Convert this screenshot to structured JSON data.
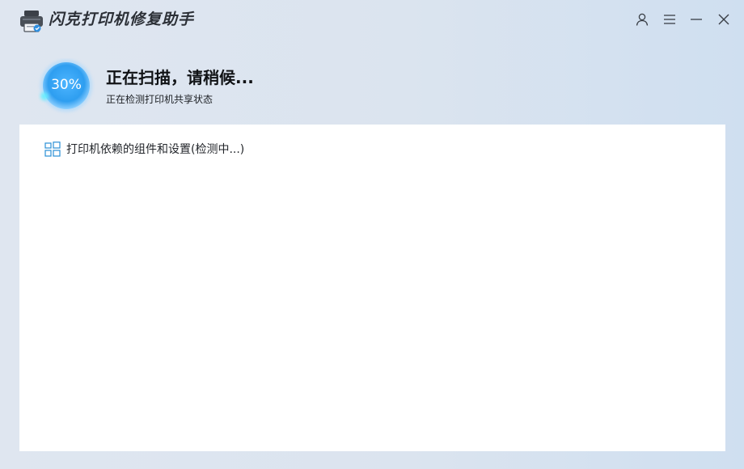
{
  "app": {
    "title": "闪克打印机修复助手",
    "logo_icon": "printer-icon"
  },
  "window_controls": [
    {
      "name": "user-icon",
      "label": "account"
    },
    {
      "name": "menu-icon",
      "label": "menu"
    },
    {
      "name": "minimize-icon",
      "label": "minimize"
    },
    {
      "name": "close-icon",
      "label": "close"
    }
  ],
  "scan": {
    "progress": 30,
    "progress_label": "30%",
    "title": "正在扫描，请稍候...",
    "subtitle": "正在检测打印机共享状态"
  },
  "check_items": [
    {
      "icon": "components-grid-icon",
      "label": "打印机依赖的组件和设置(检测中...)"
    }
  ],
  "colors": {
    "accent": "#2fa3f0",
    "accent_light": "#56c2ff",
    "background": "#dce4ef",
    "panel": "#ffffff"
  }
}
